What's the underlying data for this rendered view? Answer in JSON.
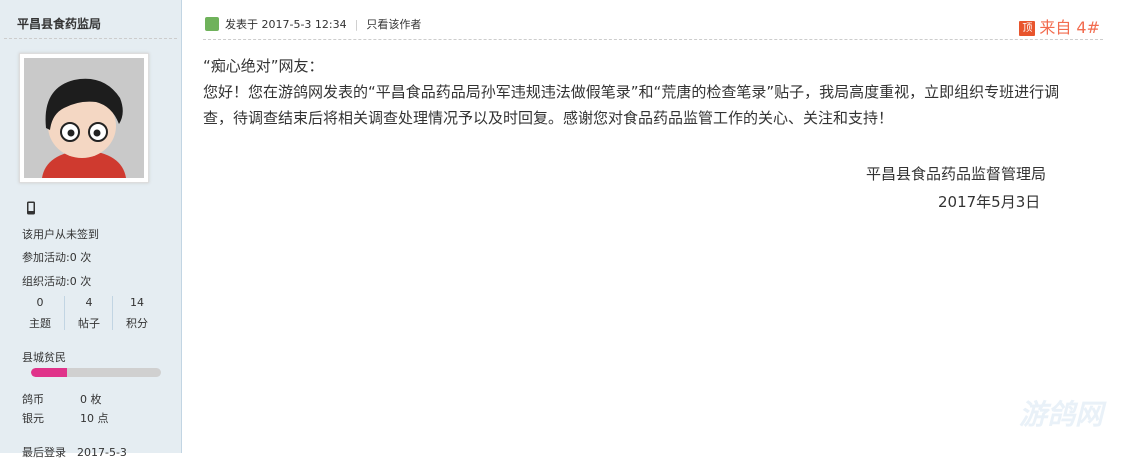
{
  "sidebar": {
    "username": "平昌县食药监局",
    "sign_status": "该用户从未签到",
    "activity_join": "参加活动:0 次",
    "activity_org": "组织活动:0 次",
    "stats": [
      {
        "value": "0",
        "label": "主题"
      },
      {
        "value": "4",
        "label": "帖子"
      },
      {
        "value": "14",
        "label": "积分"
      }
    ],
    "level": "县城贫民",
    "level_progress": 0.28,
    "level_color": "#e0338a",
    "money": [
      {
        "label": "鸽币",
        "value": "0 枚"
      },
      {
        "label": "银元",
        "value": "10 点"
      }
    ],
    "last_login_partial": "最后登录　2017-5-3"
  },
  "post": {
    "meta_posted": "发表于 2017-5-3 12:34",
    "meta_only_author": "只看该作者",
    "floor_badge": "顶",
    "floor_label": "来自 4#",
    "greeting": "“痴心绝对”网友：",
    "body": "您好！您在游鸽网发表的“平昌食品药品局孙军违规违法做假笔录”和“荒唐的检查笔录”贴子，我局高度重视，立即组织专班进行调查，待调查结束后将相关调查处理情况予以及时回复。感谢您对食品药品监管工作的关心、关注和支持！",
    "signature_org": "平昌县食品药品监督管理局",
    "signature_date": "2017年5月3日",
    "watermark": "游鸽网"
  }
}
